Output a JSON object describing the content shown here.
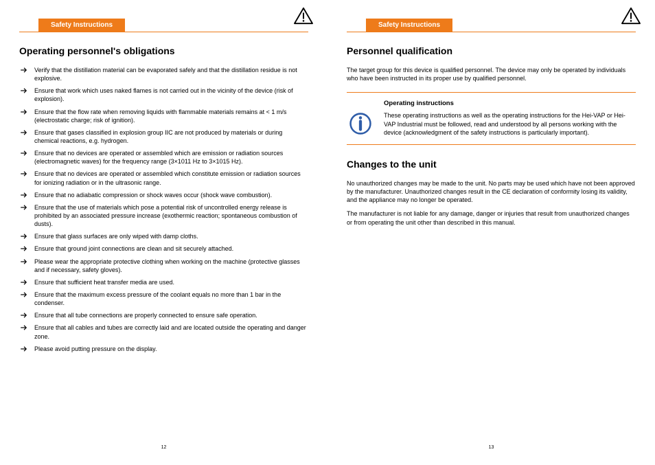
{
  "left": {
    "header_tab": "Safety Instructions",
    "page_number": "12",
    "heading": "Operating personnel's obligations",
    "items": [
      "Verify that the distillation material can be evaporated safely and that the distillation residue is not explosive.",
      "Ensure that work which uses naked flames is not carried out in the vicinity of the device (risk of explosion).",
      "Ensure that the flow rate when removing liquids with flammable materials remains at < 1 m/s (electrostatic charge; risk of ignition).",
      "Ensure that gases classified in explosion group IIC are not produced by materials or during chemical reactions, e.g. hydrogen.",
      "Ensure that no devices are operated or assembled which are emission or radiation sources (electromagnetic waves) for the frequency range (3×1011 Hz to 3×1015 Hz).",
      "Ensure that no devices are operated or assembled which constitute emission or radiation sources for ionizing radiation or in the ultrasonic range.",
      "Ensure that no adiabatic compression or shock waves occur (shock wave combustion).",
      "Ensure that the use of materials which pose a potential risk of uncontrolled energy release is prohibited by an associated pressure increase (exothermic reaction; spontaneous combustion of dusts).",
      "Ensure that glass surfaces are only wiped with damp cloths.",
      "Ensure that ground joint connections are clean and sit securely attached.",
      "Please wear the appropriate protective clothing when working on the machine (protective glasses and if necessary, safety gloves).",
      "Ensure that sufficient heat transfer media are used.",
      "Ensure that the maximum excess pressure of the coolant equals no more than 1 bar in the condenser.",
      "Ensure that all tube connections are properly connected to ensure safe operation.",
      "Ensure that all cables and tubes are correctly laid and are located outside the operating and danger zone.",
      "Please avoid putting pressure on the display."
    ]
  },
  "right": {
    "header_tab": "Safety Instructions",
    "page_number": "13",
    "section1": {
      "heading": "Personnel qualification",
      "para": "The target group for this device is qualified personnel. The device may only be operated by individuals who have been instructed in its proper use by qualified personnel.",
      "note_title": "Operating instructions",
      "note_text": "These operating instructions as well as the operating instructions for the Hei-VAP or Hei-VAP Industrial must be followed, read and understood by all persons working with the device (acknowledgment of the safety instructions is particularly important)."
    },
    "section2": {
      "heading": "Changes to the unit",
      "para1": "No unauthorized changes may be made to the unit. No parts may be used which have not been approved by the manufacturer. Unauthorized changes result in the CE declaration of conformity losing its validity, and the appliance may no longer be operated.",
      "para2": "The manufacturer is not liable for any damage, danger or injuries that result from unauthorized changes or from operating the unit other than described in this manual."
    }
  }
}
